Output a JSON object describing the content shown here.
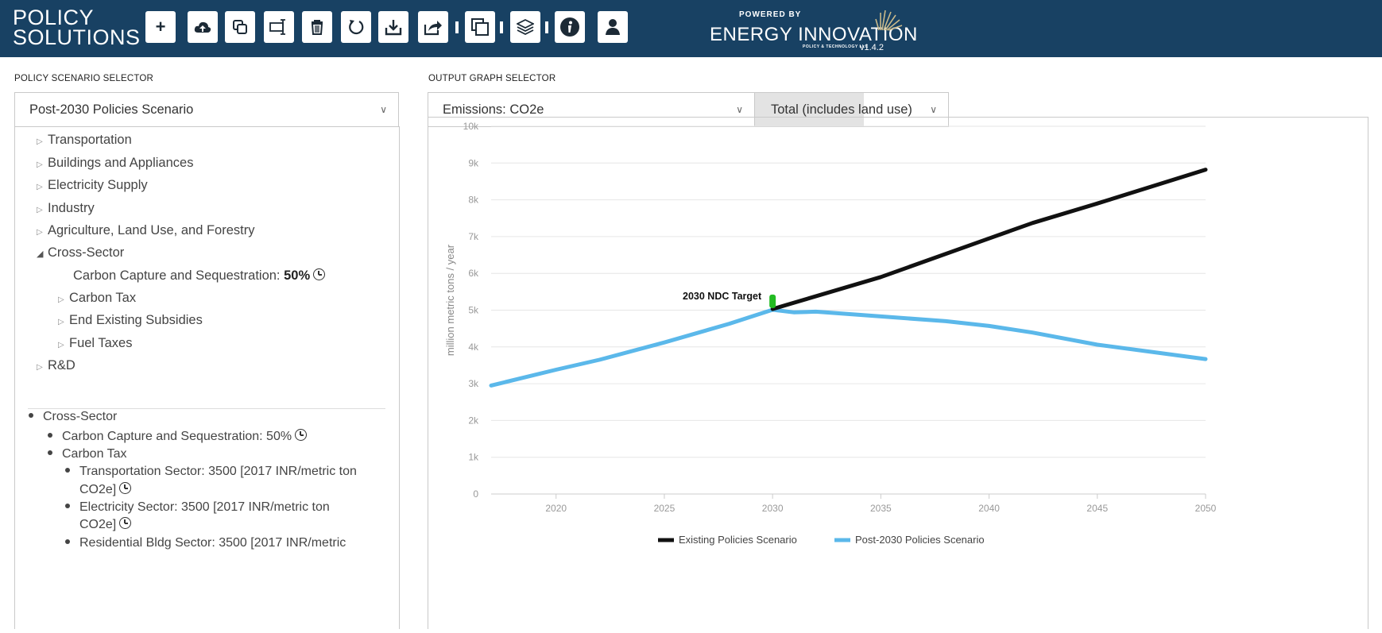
{
  "app": {
    "brand_line1": "POLICY",
    "brand_line2": "SOLUTIONS",
    "powered_by": "POWERED BY",
    "partner_name": "ENERGY INNOVATION",
    "partner_sub": "POLICY & TECHNOLOGY LLC",
    "version": "v1.4.2"
  },
  "toolbar": {
    "icons": [
      "plus-icon",
      "cloud-upload-icon",
      "copy-icon",
      "text-cursor-icon",
      "trash-icon",
      "undo-icon",
      "download-icon",
      "share-icon",
      "window-icon",
      "layers-icon",
      "info-icon",
      "user-icon"
    ]
  },
  "scenario": {
    "section_label": "POLICY SCENARIO SELECTOR",
    "selected": "Post-2030 Policies Scenario"
  },
  "tree": {
    "transportation": "Transportation",
    "buildings": "Buildings and Appliances",
    "electricity": "Electricity Supply",
    "industry": "Industry",
    "agriculture": "Agriculture, Land Use, and Forestry",
    "cross_sector": "Cross-Sector",
    "ccs_label": "Carbon Capture and Sequestration:",
    "ccs_value": "50%",
    "carbon_tax": "Carbon Tax",
    "end_subsidies": "End Existing Subsidies",
    "fuel_taxes": "Fuel Taxes",
    "rd": "R&D"
  },
  "summary": {
    "cross_sector": "Cross-Sector",
    "ccs": "Carbon Capture and Sequestration: 50%",
    "carbon_tax": "Carbon Tax",
    "transport_1": "Transportation Sector: 3500 [2017 INR/metric ton",
    "transport_2": "CO2e]",
    "electricity_1": "Electricity Sector: 3500 [2017 INR/metric ton",
    "electricity_2": "CO2e]",
    "residential_1": "Residential Bldg Sector: 3500 [2017 INR/metric"
  },
  "output": {
    "section_label": "OUTPUT GRAPH SELECTOR",
    "graph_selected": "Emissions: CO2e",
    "scope_selected": "Total (includes land use)"
  },
  "colors": {
    "header_bg": "#184163",
    "existing_line": "#111111",
    "post2030_line": "#5bb8ea",
    "target_marker": "#22bb22"
  },
  "chart_data": {
    "type": "line",
    "ylabel": "million metric tons / year",
    "xlabel": "",
    "ylim": [
      0,
      10000
    ],
    "xlim": [
      2017,
      2050
    ],
    "y_ticks": [
      "0",
      "1k",
      "2k",
      "3k",
      "4k",
      "5k",
      "6k",
      "7k",
      "8k",
      "9k",
      "10k"
    ],
    "x_ticks": [
      "2020",
      "2025",
      "2030",
      "2035",
      "2040",
      "2045",
      "2050"
    ],
    "grid": true,
    "legend_position": "bottom",
    "annotation": {
      "label": "2030 NDC Target",
      "x": 2030,
      "y": 5250
    },
    "series": [
      {
        "name": "Existing Policies Scenario",
        "x": [
          2030,
          2035,
          2040,
          2042,
          2045,
          2050
        ],
        "y": [
          5030,
          5900,
          6950,
          7370,
          7900,
          8820
        ]
      },
      {
        "name": "Post-2030 Policies Scenario",
        "x": [
          2017,
          2020,
          2022,
          2025,
          2028,
          2030,
          2031,
          2032,
          2035,
          2038,
          2040,
          2042,
          2045,
          2050
        ],
        "y": [
          2950,
          3380,
          3650,
          4120,
          4630,
          5010,
          4940,
          4960,
          4830,
          4700,
          4570,
          4390,
          4060,
          3670
        ]
      }
    ]
  }
}
